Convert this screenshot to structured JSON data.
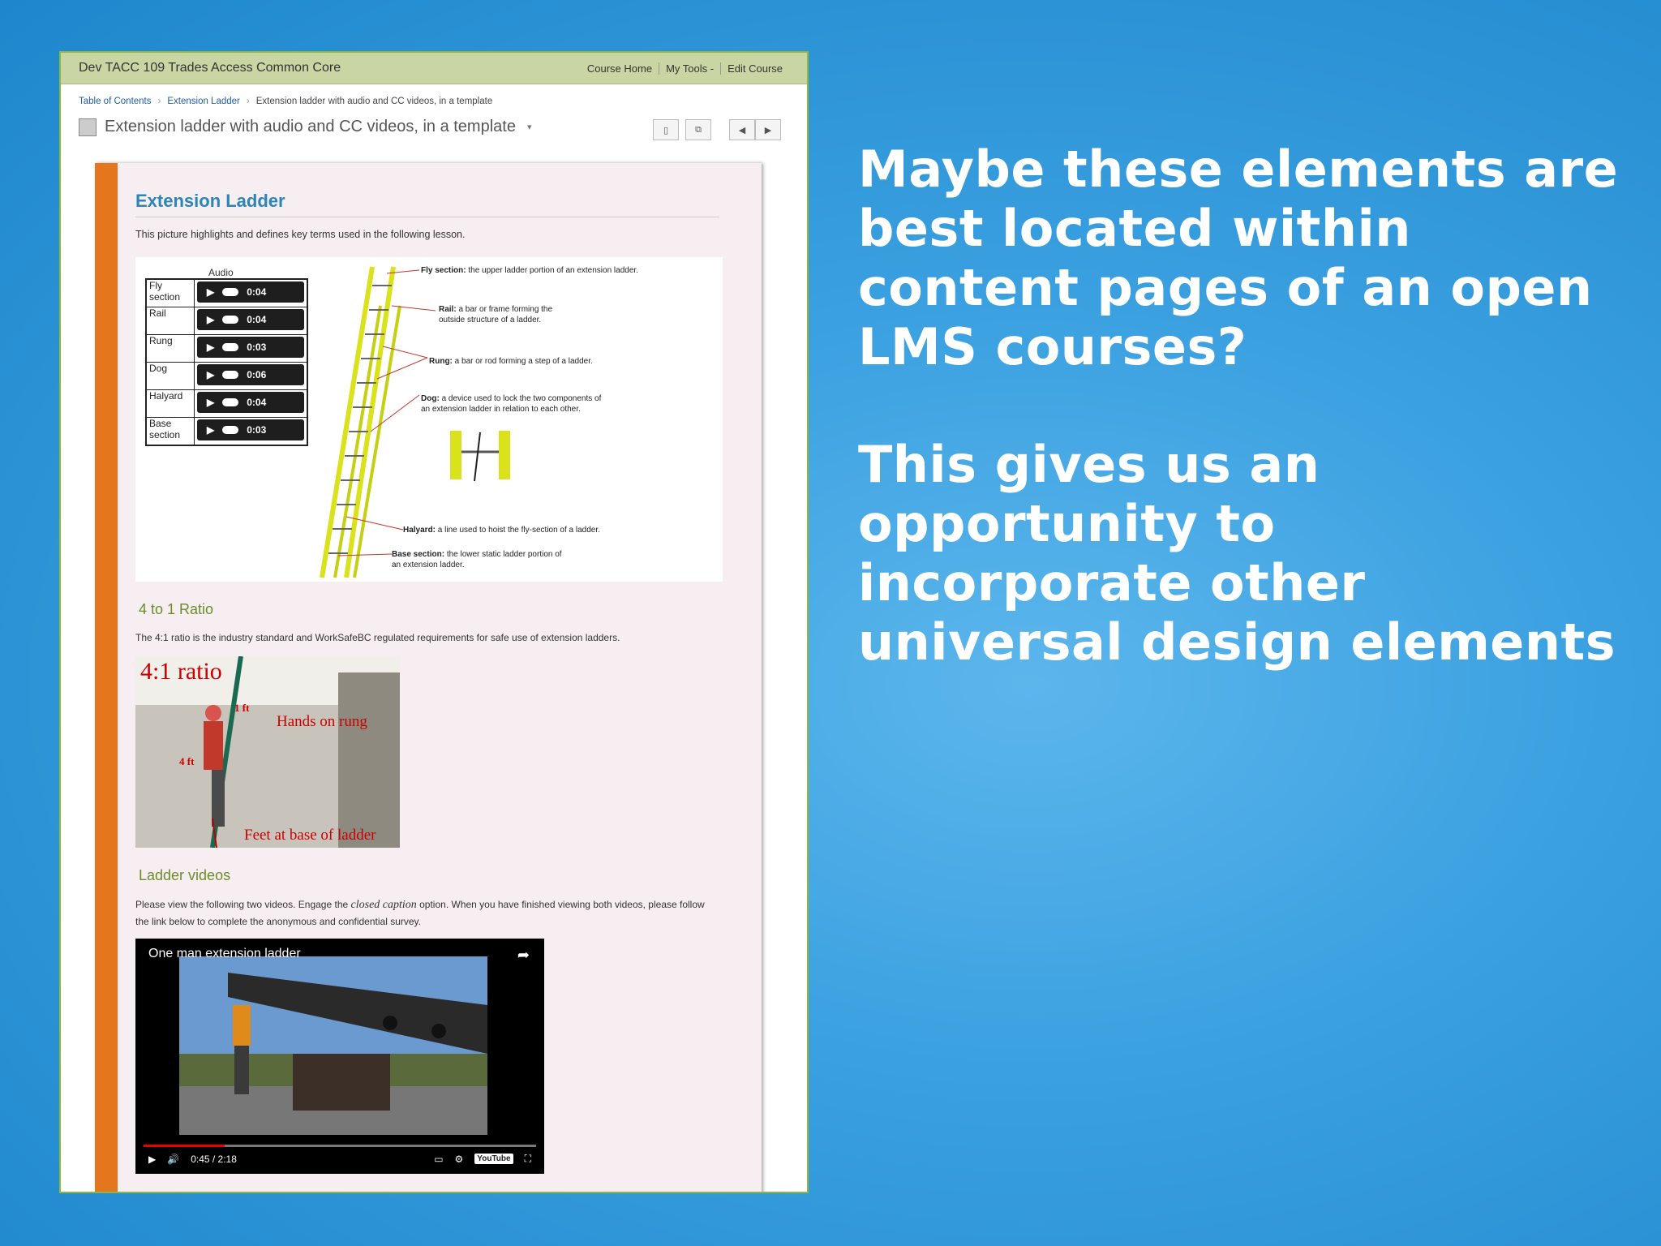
{
  "slide": {
    "paragraph1": "Maybe these elements are best located within content pages of an open LMS courses?",
    "paragraph2": "This gives us an opportunity to incorporate other universal design elements"
  },
  "lms": {
    "course_title": "Dev TACC 109 Trades Access Common Core",
    "nav": [
      "Course Home",
      "My Tools -",
      "Edit Course"
    ],
    "breadcrumb": [
      "Table of Contents",
      "Extension Ladder",
      "Extension ladder with audio and CC videos, in a template"
    ],
    "page_title": "Extension ladder with audio and CC videos, in a template",
    "toolbar_icons": [
      "bookmark-icon",
      "new-window-icon",
      "previous-icon",
      "next-icon"
    ]
  },
  "content": {
    "title": "Extension Ladder",
    "intro": "This picture highlights and defines key terms used in the following lesson.",
    "audio_header": "Audio",
    "audio_rows": [
      {
        "label": "Fly section",
        "time": "0:04"
      },
      {
        "label": "Rail",
        "time": "0:04"
      },
      {
        "label": "Rung",
        "time": "0:03"
      },
      {
        "label": "Dog",
        "time": "0:06"
      },
      {
        "label": "Halyard",
        "time": "0:04"
      },
      {
        "label": "Base section",
        "time": "0:03"
      }
    ],
    "callouts": {
      "fly_term": "Fly section:",
      "fly_def": "the upper ladder portion of an extension ladder.",
      "rail_term": "Rail:",
      "rail_def": "a bar or frame forming the outside structure of a ladder.",
      "rung_term": "Rung:",
      "rung_def": "a bar or rod forming a step of a ladder.",
      "dog_term": "Dog:",
      "dog_def": "a device used to lock the two components of an extension ladder in relation to each other.",
      "halyard_term": "Halyard:",
      "halyard_def": "a line used to hoist the fly-section of a ladder.",
      "base_term": "Base section:",
      "base_def": "the lower static ladder portion of an extension ladder."
    },
    "ratio_heading": "4 to 1 Ratio",
    "ratio_text": "The 4:1 ratio is the industry standard and WorkSafeBC regulated requirements for safe use of extension ladders.",
    "ratio_image": {
      "title": "4:1 ratio",
      "label_1ft": "1 ft",
      "label_4ft": "4 ft",
      "hands": "Hands on rung",
      "feet": "Feet at base of ladder"
    },
    "videos_heading": "Ladder videos",
    "videos_text_a": "Please view the following two videos. Engage the",
    "videos_text_em": "closed caption",
    "videos_text_b": "option. When you have finished viewing both videos, please follow the link below to complete the anonymous and confidential survey.",
    "video": {
      "title": "One man extension ladder",
      "time": "0:45 / 2:18",
      "progress": 0.206,
      "brand": "YouTube"
    }
  }
}
